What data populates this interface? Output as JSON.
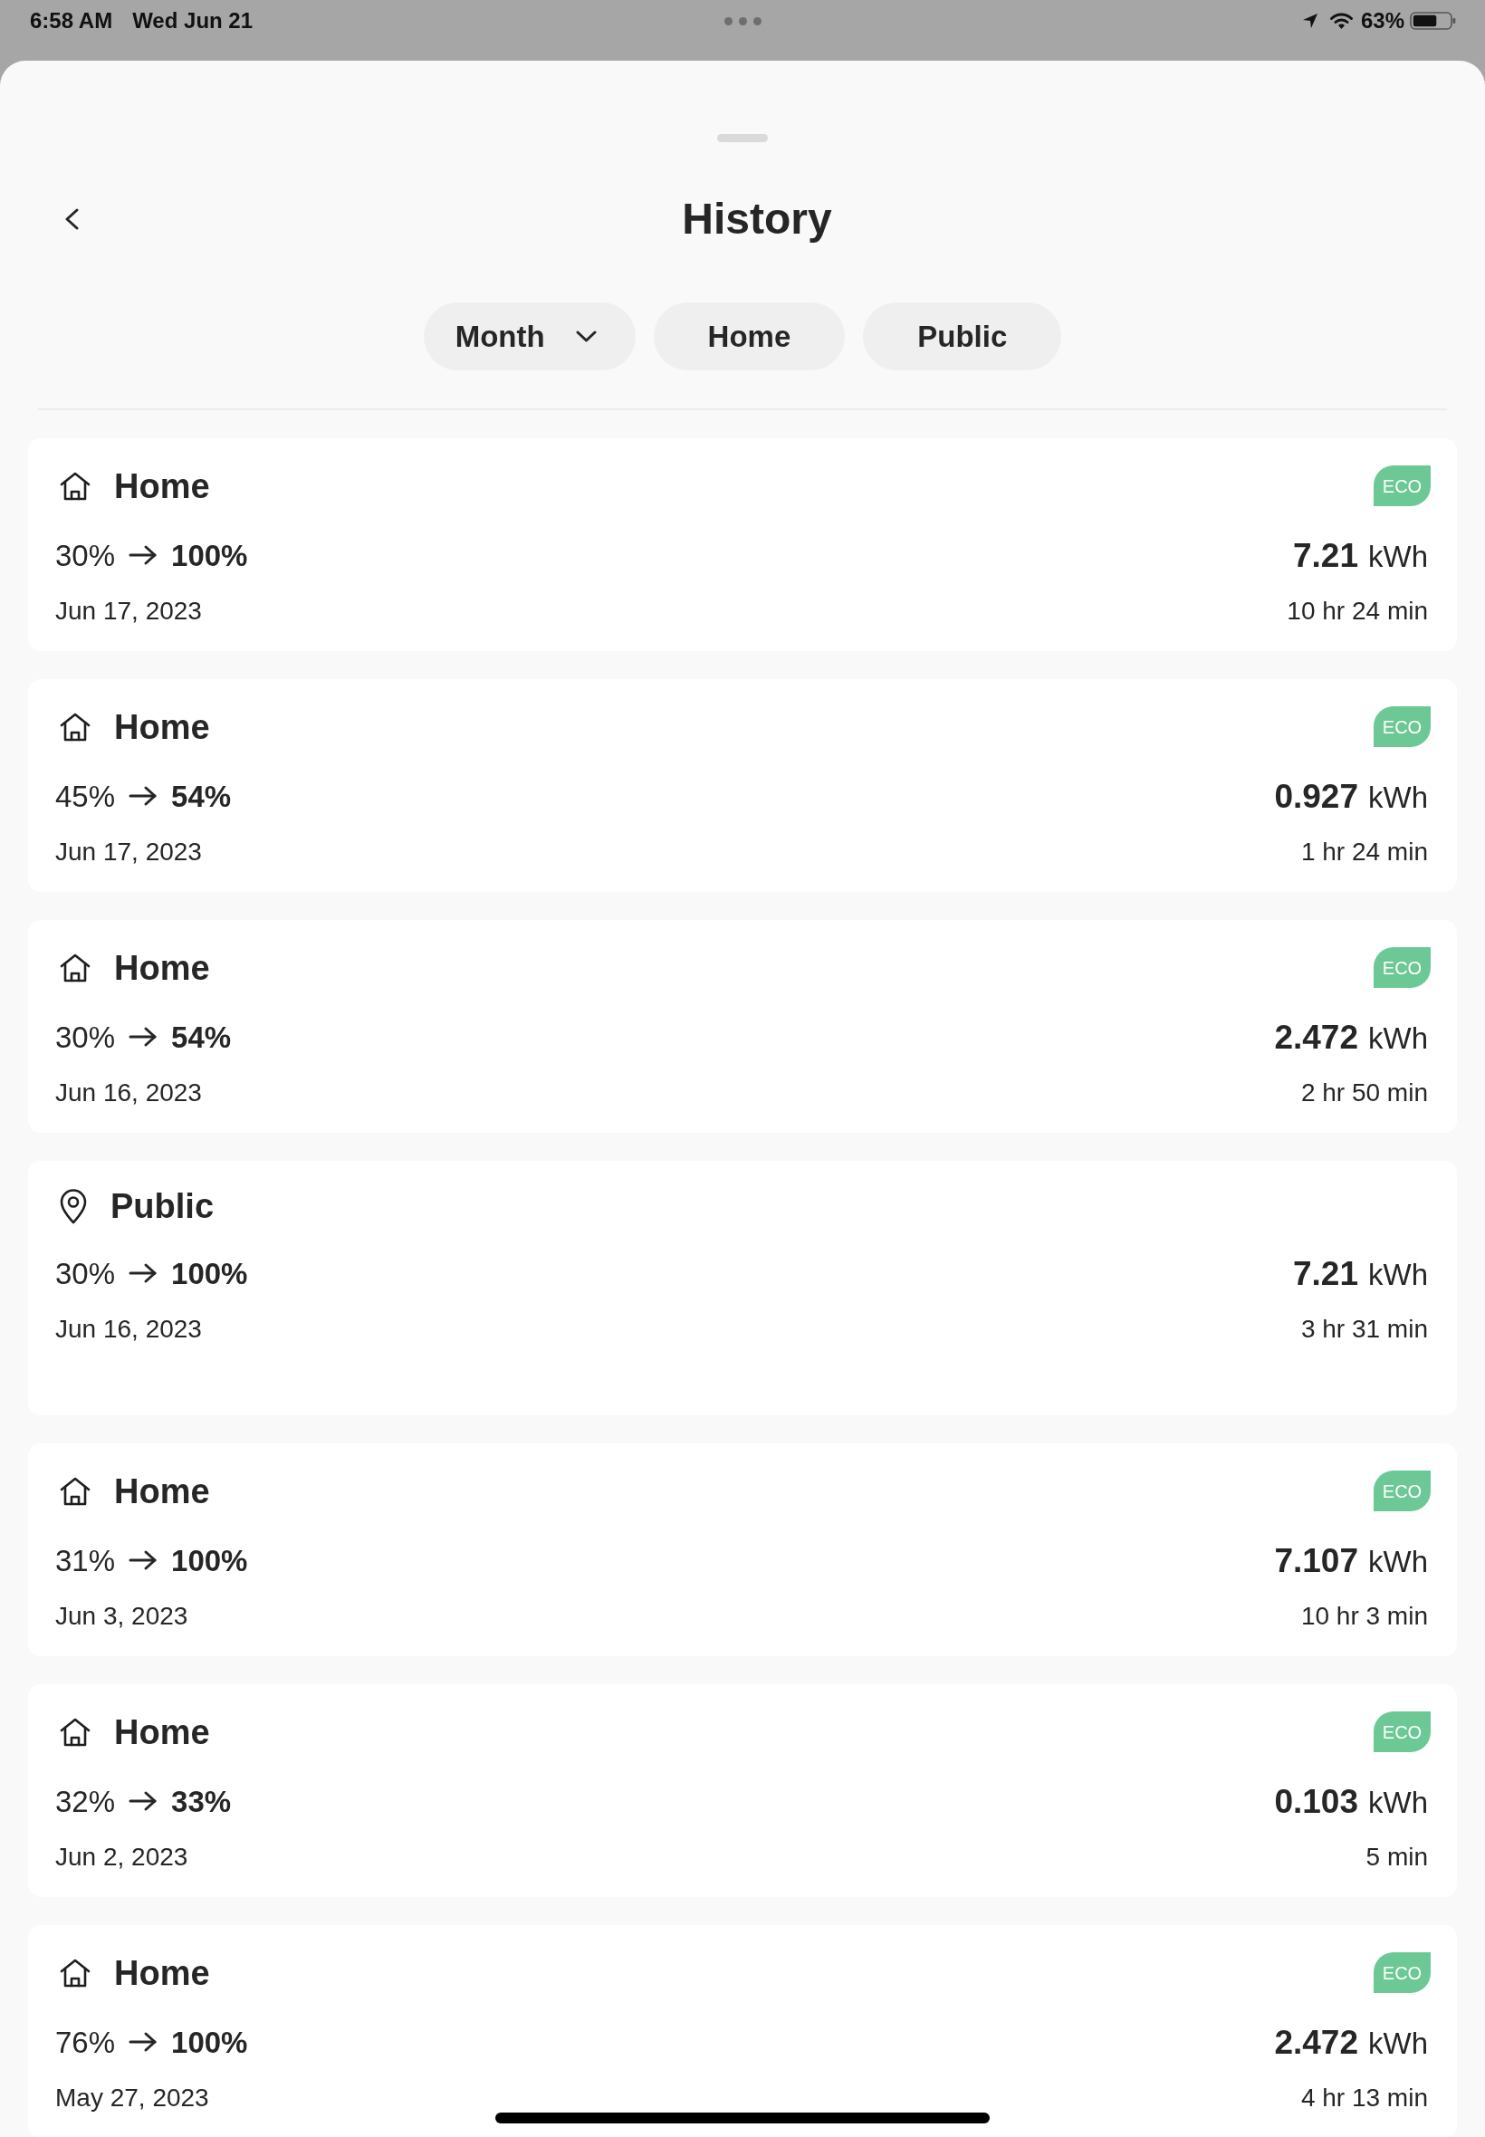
{
  "status_bar": {
    "time": "6:58 AM",
    "date": "Wed Jun 21",
    "battery": "63%"
  },
  "header": {
    "title": "History"
  },
  "filters": [
    {
      "kind": "dropdown",
      "label": "Month",
      "selected": false
    },
    {
      "kind": "chip",
      "label": "Home",
      "selected": false
    },
    {
      "kind": "chip",
      "label": "Public",
      "selected": false
    }
  ],
  "sessions": [
    {
      "kind": "home",
      "title": "Home",
      "badge": "ECO",
      "start": "30%",
      "end": "100%",
      "energy": "7.21",
      "unit": "kWh",
      "date": "Jun 17, 2023",
      "duration": "10 hr 24 min"
    },
    {
      "kind": "home",
      "title": "Home",
      "badge": "ECO",
      "start": "45%",
      "end": "54%",
      "energy": "0.927",
      "unit": "kWh",
      "date": "Jun 17, 2023",
      "duration": "1 hr 24 min"
    },
    {
      "kind": "home",
      "title": "Home",
      "badge": "ECO",
      "start": "30%",
      "end": "54%",
      "energy": "2.472",
      "unit": "kWh",
      "date": "Jun 16, 2023",
      "duration": "2 hr 50 min"
    },
    {
      "kind": "public",
      "title": "Public",
      "start": "30%",
      "end": "100%",
      "energy": "7.21",
      "unit": "kWh",
      "date": "Jun 16, 2023",
      "duration": "3 hr 31 min"
    },
    {
      "kind": "home",
      "title": "Home",
      "badge": "ECO",
      "start": "31%",
      "end": "100%",
      "energy": "7.107",
      "unit": "kWh",
      "date": "Jun 3, 2023",
      "duration": "10 hr 3 min"
    },
    {
      "kind": "home",
      "title": "Home",
      "badge": "ECO",
      "start": "32%",
      "end": "33%",
      "energy": "0.103",
      "unit": "kWh",
      "date": "Jun 2, 2023",
      "duration": "5 min"
    },
    {
      "kind": "home",
      "title": "Home",
      "badge": "ECO",
      "start": "76%",
      "end": "100%",
      "energy": "2.472",
      "unit": "kWh",
      "date": "May 27, 2023",
      "duration": "4 hr 13 min"
    }
  ]
}
